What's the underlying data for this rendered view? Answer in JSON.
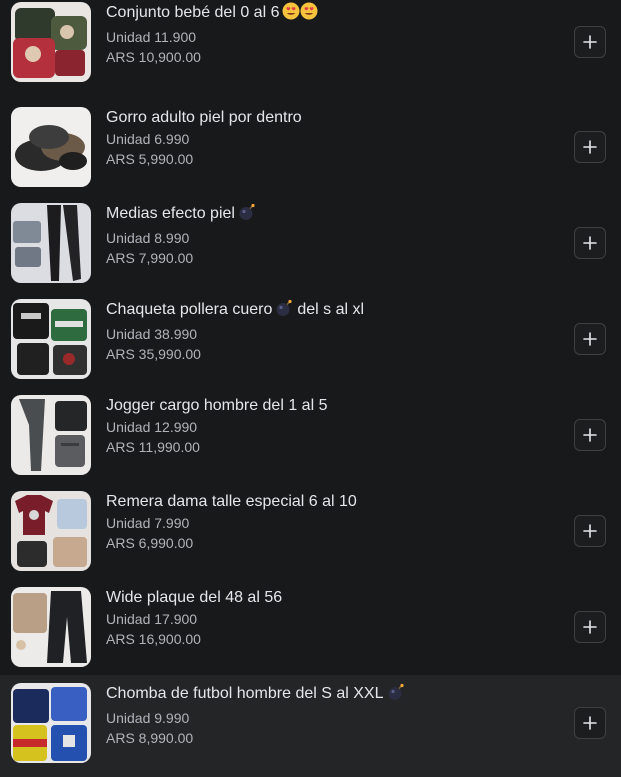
{
  "products": [
    {
      "title": "Conjunto bebé del 0 al 6",
      "emoji": "heart-eyes-emoji",
      "emoji_count": 2,
      "unit": "Unidad 11.900",
      "price": "ARS 10,900.00",
      "thumb": "baby-set-thumbnail"
    },
    {
      "title": "Gorro adulto piel por dentro",
      "emoji": "",
      "emoji_count": 0,
      "unit": "Unidad 6.990",
      "price": "ARS 5,990.00",
      "thumb": "beanie-thumbnail"
    },
    {
      "title": "Medias efecto piel",
      "emoji": "bomb-emoji",
      "emoji_count": 1,
      "unit": "Unidad 8.990",
      "price": "ARS 7,990.00",
      "thumb": "tights-thumbnail"
    },
    {
      "title": "Chaqueta pollera cuero",
      "title_after": "del s al xl",
      "emoji": "bomb-emoji",
      "emoji_count": 1,
      "unit": "Unidad 38.990",
      "price": "ARS 35,990.00",
      "thumb": "jacket-thumbnail"
    },
    {
      "title": "Jogger cargo hombre del 1 al 5",
      "emoji": "",
      "emoji_count": 0,
      "unit": "Unidad 12.990",
      "price": "ARS 11,990.00",
      "thumb": "jogger-thumbnail"
    },
    {
      "title": "Remera dama talle especial 6 al 10",
      "emoji": "",
      "emoji_count": 0,
      "unit": "Unidad 7.990",
      "price": "ARS 6,990.00",
      "thumb": "tshirt-thumbnail"
    },
    {
      "title": "Wide plaque del 48 al 56",
      "emoji": "",
      "emoji_count": 0,
      "unit": "Unidad 17.900",
      "price": "ARS 16,900.00",
      "thumb": "wide-pants-thumbnail"
    },
    {
      "title": "Chomba de futbol hombre del S al XXL",
      "emoji": "bomb-emoji",
      "emoji_count": 1,
      "unit": "Unidad 9.990",
      "price": "ARS 8,990.00",
      "thumb": "soccer-shirt-thumbnail"
    }
  ],
  "colors": {
    "background": "#18191a",
    "highlight_row": "#242526",
    "title_text": "#e4e6eb",
    "secondary_text": "#b0b3b8",
    "button_border": "#3e4042"
  },
  "add_button_icon": "plus-icon",
  "highlighted_index": 7
}
